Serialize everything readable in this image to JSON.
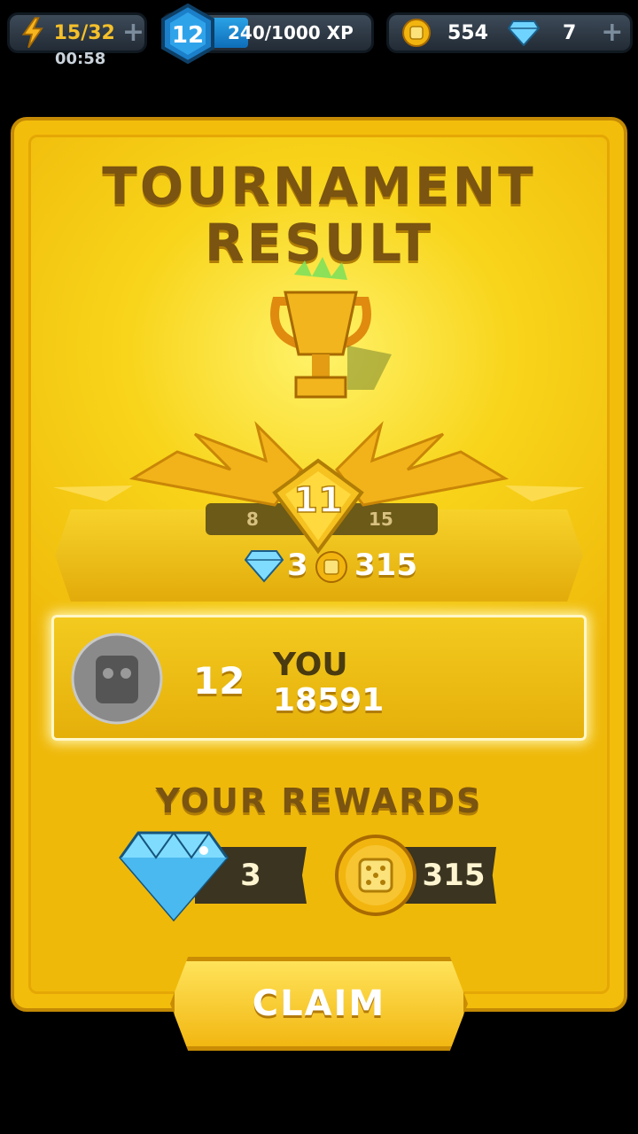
{
  "hud": {
    "energy": "15/32",
    "energy_timer": "00:58",
    "level": "12",
    "xp": "240/1000 XP",
    "xp_progress": 0.24,
    "coins": "554",
    "gems": "7"
  },
  "title_line1": "TOURNAMENT",
  "title_line2": "RESULT",
  "rank": {
    "position": "11",
    "prev": "8",
    "next": "15",
    "gems_reward": "3",
    "coins_reward": "315"
  },
  "player": {
    "rank": "12",
    "name": "YOU",
    "score": "18591"
  },
  "rewards": {
    "heading": "YOUR REWARDS",
    "gems": "3",
    "coins": "315"
  },
  "claim_label": "CLAIM",
  "colors": {
    "panel": "#f3bd0b",
    "title_text": "#7a5410",
    "hud_bg": "#2c3640",
    "xp_fill": "#1f8ad6",
    "energy_text": "#f5c02a"
  }
}
